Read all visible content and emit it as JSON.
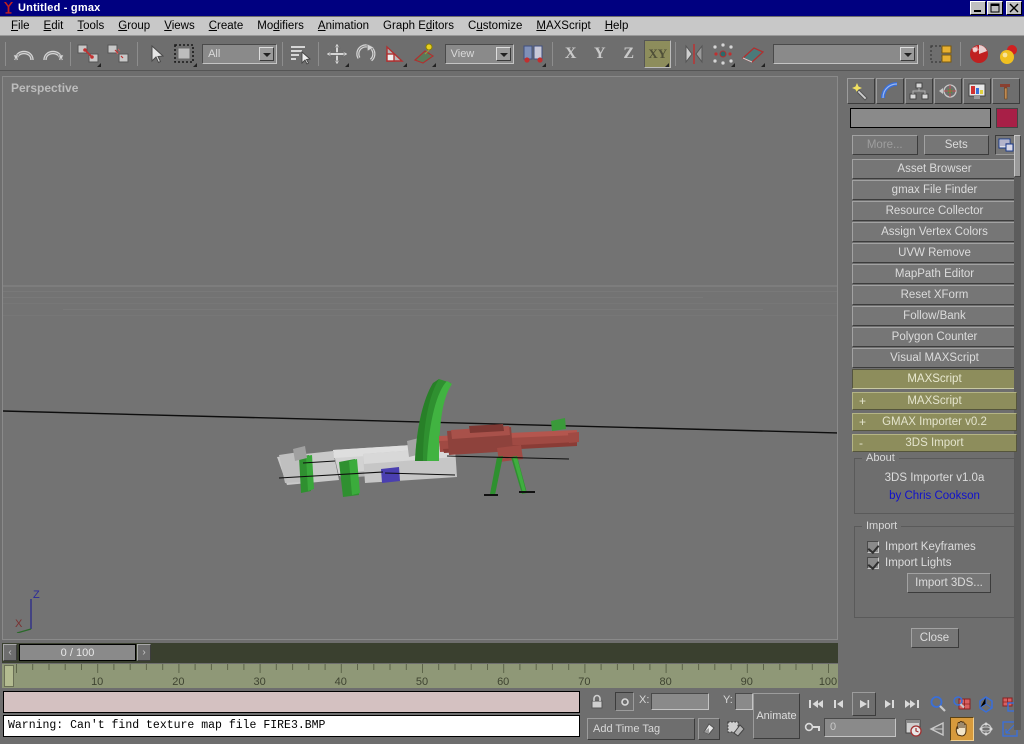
{
  "window": {
    "title": "Untitled - gmax",
    "app_icon": "gmax-logo-icon",
    "minimize": "_",
    "maximize": "❐",
    "close": "✕"
  },
  "menubar": {
    "items": [
      {
        "label": "File",
        "accel": "F"
      },
      {
        "label": "Edit",
        "accel": "E"
      },
      {
        "label": "Tools",
        "accel": "T"
      },
      {
        "label": "Group",
        "accel": "G"
      },
      {
        "label": "Views",
        "accel": "V"
      },
      {
        "label": "Create",
        "accel": "C"
      },
      {
        "label": "Modifiers",
        "accel": "d"
      },
      {
        "label": "Animation",
        "accel": "A"
      },
      {
        "label": "Graph Editors",
        "accel": "d"
      },
      {
        "label": "Customize",
        "accel": "u"
      },
      {
        "label": "MAXScript",
        "accel": "M"
      },
      {
        "label": "Help",
        "accel": "H"
      }
    ]
  },
  "toolbar": {
    "undo": "undo-icon",
    "redo": "redo-icon",
    "select_and_link": "select-and-link-icon",
    "unlink_selection": "unlink-selection-icon",
    "select_object": "select-object-arrow-icon",
    "select_region": "select-region-icon",
    "selection_filter_value": "All",
    "select_by_name": "select-by-name-icon",
    "select_and_move": "select-and-move-icon",
    "select_and_rotate": "select-and-rotate-icon",
    "select_and_scale": "select-and-scale-icon",
    "reference_coordinate_system_value": "View",
    "use_pivot_point_center": "use-pivot-point-center-icon",
    "restrict_x": "X",
    "restrict_y": "Y",
    "restrict_z": "Z",
    "restrict_plane": "XY",
    "mirror": "mirror-icon",
    "array": "array-icon",
    "align": "align-icon",
    "named_selection_sets_value": "",
    "layer_manager": "layer-manager-icon",
    "material_editor": "material-editor-icon",
    "render_scene": "render-scene-icon"
  },
  "viewport": {
    "label": "Perspective",
    "axis_z": "Z",
    "axis_x": "X",
    "scene_description": "low-poly machine gun model"
  },
  "timeslider": {
    "prev_frame": "‹",
    "next_frame": "›",
    "value": "0 / 100"
  },
  "trackbar": {
    "ticks": [
      10,
      20,
      30,
      40,
      50,
      60,
      70,
      80,
      90,
      100
    ],
    "start": 0,
    "end": 100
  },
  "status": {
    "prompt_value": "",
    "message": "Warning: Can't find texture map file FIRE3.BMP"
  },
  "coordbar": {
    "lock_selection": "lock-selection-icon",
    "absolute_mode": "absolute-relative-transform-icon",
    "x_label": "X:",
    "x_value": "",
    "y_label": "Y:",
    "y_value": "",
    "add_time_tag": "Add Time Tag",
    "key_mode": "key-mode-icon",
    "auto_key_filters": "key-filters-icon",
    "animate_label": "Animate"
  },
  "playback": {
    "go_to_start": "go-to-start-icon",
    "previous_frame": "previous-frame-icon",
    "play_animation": "play-animation-icon",
    "next_frame": "next-frame-icon",
    "go_to_end": "go-to-end-icon",
    "current_frame_value": "0",
    "set_key": "set-key-icon",
    "time_configuration": "time-configuration-icon"
  },
  "viewport_nav": {
    "zoom": "zoom-icon",
    "zoom_all": "zoom-all-icon",
    "zoom_extents": "zoom-extents-icon",
    "zoom_region": "zoom-region-icon",
    "field_of_view": "field-of-view-icon",
    "pan": "pan-hand-icon",
    "arc_rotate": "arc-rotate-icon",
    "min_max_toggle": "min-max-toggle-icon",
    "active_tool": "pan-hand-icon"
  },
  "command_panel": {
    "tabs": [
      {
        "name": "create-tab",
        "icon": "star-wand-icon"
      },
      {
        "name": "modify-tab",
        "icon": "arc-modify-icon"
      },
      {
        "name": "hierarchy-tab",
        "icon": "hierarchy-icon"
      },
      {
        "name": "motion-tab",
        "icon": "motion-wheel-icon"
      },
      {
        "name": "display-tab",
        "icon": "display-monitor-icon"
      },
      {
        "name": "utilities-tab",
        "icon": "hammer-icon"
      }
    ],
    "active_tab": "utilities-tab",
    "object_name_value": "",
    "object_color": "#a81f47",
    "utilities": {
      "more_button": "More...",
      "sets_button": "Sets",
      "configure_button_sets_icon": "configure-button-sets-icon",
      "buttons": [
        "Asset Browser",
        "gmax File Finder",
        "Resource Collector",
        "Assign Vertex Colors",
        "UVW Remove",
        "MapPath Editor",
        "Reset XForm",
        "Follow/Bank",
        "Polygon Counter",
        "Visual MAXScript",
        "MAXScript"
      ],
      "selected_button": "MAXScript"
    },
    "rollouts": [
      {
        "label": "MAXScript",
        "state": "+"
      },
      {
        "label": "GMAX Importer v0.2",
        "state": "+"
      },
      {
        "label": "3DS Import",
        "state": "-"
      }
    ],
    "about_group": {
      "title": "About",
      "product": "3DS Importer v1.0a",
      "author": "by Chris Cookson"
    },
    "import_group": {
      "title": "Import",
      "checkboxes": [
        {
          "label": "Import Keyframes",
          "checked": true
        },
        {
          "label": "Import Lights",
          "checked": true
        }
      ],
      "import_button": "Import 3DS..."
    },
    "close_button": "Close"
  },
  "colors": {
    "titlebar": "#000080",
    "menubar": "#c8c8c8",
    "chrome": "#6e6e6e",
    "viewport": "#737373",
    "highlight_olive": "#8d8d5c",
    "trackbar": "#8f9877",
    "timeslider": "#3a402f",
    "warning_bg": "#ffffff",
    "prompt_bg": "#d4c1c1",
    "active_tool": "#d79a3c",
    "object_color": "#a81f47",
    "author_link": "#1111cc"
  }
}
